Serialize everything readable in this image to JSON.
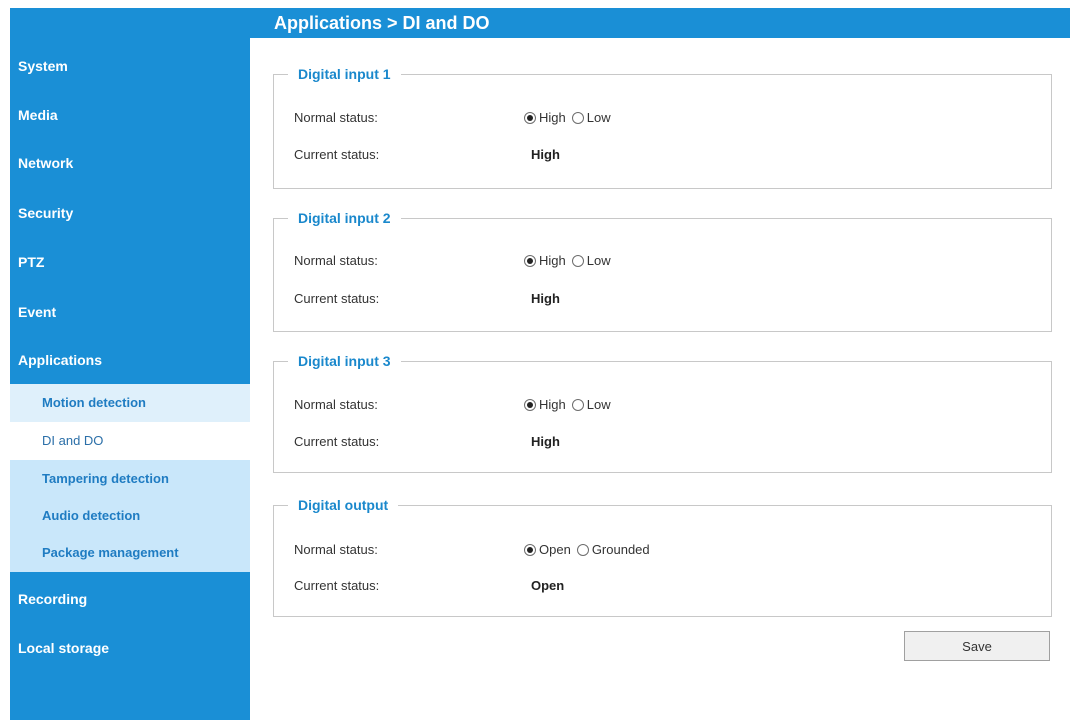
{
  "header": {
    "breadcrumb": "Applications  > DI and DO"
  },
  "sidebar": {
    "items": [
      {
        "label": "System"
      },
      {
        "label": "Media"
      },
      {
        "label": "Network"
      },
      {
        "label": "Security"
      },
      {
        "label": "PTZ"
      },
      {
        "label": "Event"
      },
      {
        "label": "Applications"
      },
      {
        "label": "Recording"
      },
      {
        "label": "Local storage"
      }
    ],
    "submenu": [
      {
        "label": "Motion detection"
      },
      {
        "label": "DI and DO",
        "active": true
      },
      {
        "label": "Tampering detection"
      },
      {
        "label": "Audio detection"
      },
      {
        "label": "Package management"
      }
    ]
  },
  "sections": [
    {
      "legend": "Digital input 1",
      "normal_label": "Normal status:",
      "current_label": "Current status:",
      "options": [
        "High",
        "Low"
      ],
      "selected": "High",
      "current_value": "High"
    },
    {
      "legend": "Digital input 2",
      "normal_label": "Normal status:",
      "current_label": "Current status:",
      "options": [
        "High",
        "Low"
      ],
      "selected": "High",
      "current_value": "High"
    },
    {
      "legend": "Digital input 3",
      "normal_label": "Normal status:",
      "current_label": "Current status:",
      "options": [
        "High",
        "Low"
      ],
      "selected": "High",
      "current_value": "High"
    },
    {
      "legend": "Digital output",
      "normal_label": "Normal status:",
      "current_label": "Current status:",
      "options": [
        "Open",
        "Grounded"
      ],
      "selected": "Open",
      "current_value": "Open"
    }
  ],
  "actions": {
    "save_label": "Save"
  },
  "colors": {
    "brand_blue": "#1a8fd6",
    "submenu_bg": "#c9e7fa",
    "legend_text": "#1a88cc"
  }
}
